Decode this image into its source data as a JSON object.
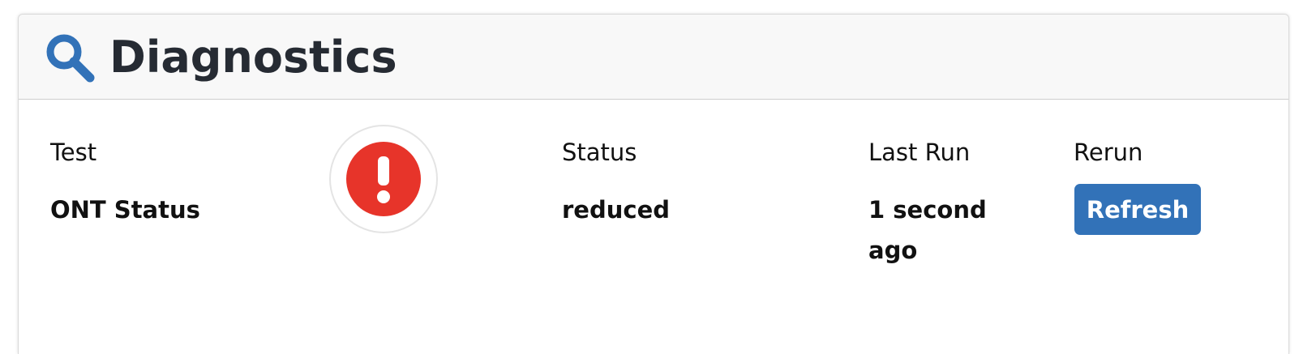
{
  "header": {
    "title": "Diagnostics",
    "icon": "search-icon",
    "icon_color": "#3272b8"
  },
  "table": {
    "columns": {
      "test": "Test",
      "status": "Status",
      "last_run": "Last Run",
      "rerun": "Rerun"
    },
    "rows": [
      {
        "test": "ONT Status",
        "status_icon": "exclamation-circle-icon",
        "status_icon_color": "#e7342a",
        "status": "reduced",
        "last_run_line1": "1 second",
        "last_run_line2": "ago",
        "rerun_label": "Refresh",
        "rerun_color": "#3272b8"
      }
    ]
  }
}
